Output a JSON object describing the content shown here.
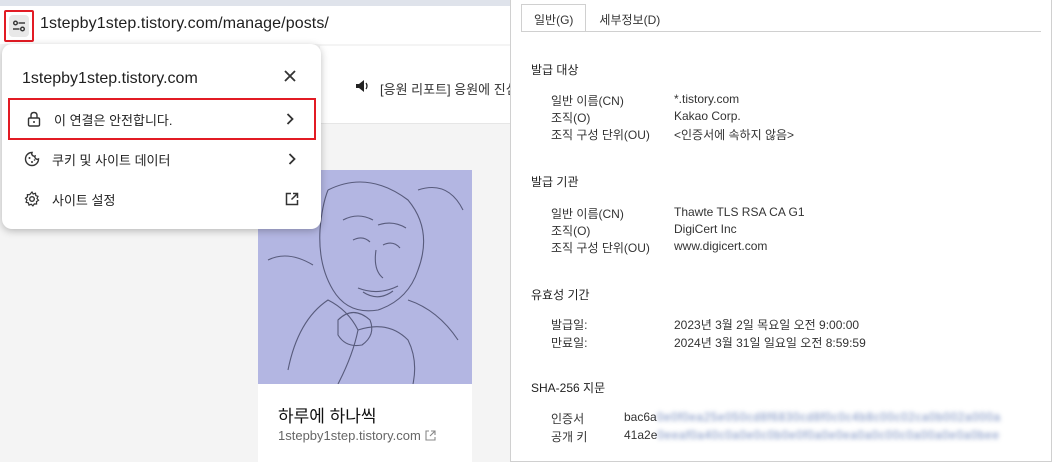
{
  "browser": {
    "url": "1stepby1step.tistory.com/manage/posts/",
    "notice_text": "[응원 리포트] 응원에 진심",
    "card": {
      "title": "하루에 하나씩",
      "url": "1stepby1step.tistory.com"
    }
  },
  "popup": {
    "site": "1stepby1step.tistory.com",
    "items": [
      {
        "label": "이 연결은 안전합니다."
      },
      {
        "label": "쿠키 및 사이트 데이터"
      },
      {
        "label": "사이트 설정"
      }
    ]
  },
  "cert": {
    "tabs": [
      {
        "label": "일반(G)",
        "active": true
      },
      {
        "label": "세부정보(D)",
        "active": false
      }
    ],
    "issued_to": {
      "heading": "발급 대상",
      "cn_label": "일반 이름(CN)",
      "cn_value": "*.tistory.com",
      "o_label": "조직(O)",
      "o_value": "Kakao Corp.",
      "ou_label": "조직 구성 단위(OU)",
      "ou_value": "<인증서에 속하지 않음>"
    },
    "issued_by": {
      "heading": "발급 기관",
      "cn_label": "일반 이름(CN)",
      "cn_value": "Thawte TLS RSA CA G1",
      "o_label": "조직(O)",
      "o_value": "DigiCert Inc",
      "ou_label": "조직 구성 단위(OU)",
      "ou_value": "www.digicert.com"
    },
    "validity": {
      "heading": "유효성 기간",
      "issued_label": "발급일:",
      "issued_value": "2023년 3월 2일 목요일 오전 9:00:00",
      "expires_label": "만료일:",
      "expires_value": "2024년 3월 31일 일요일 오전 8:59:59"
    },
    "fingerprints": {
      "heading": "SHA-256 지문",
      "cert_label": "인증서",
      "cert_value": "bac6a",
      "key_label": "공개 키",
      "key_value": "41a2e"
    }
  },
  "colors": {
    "highlight": "#e21b24",
    "card_image": "#b3b6e2"
  }
}
